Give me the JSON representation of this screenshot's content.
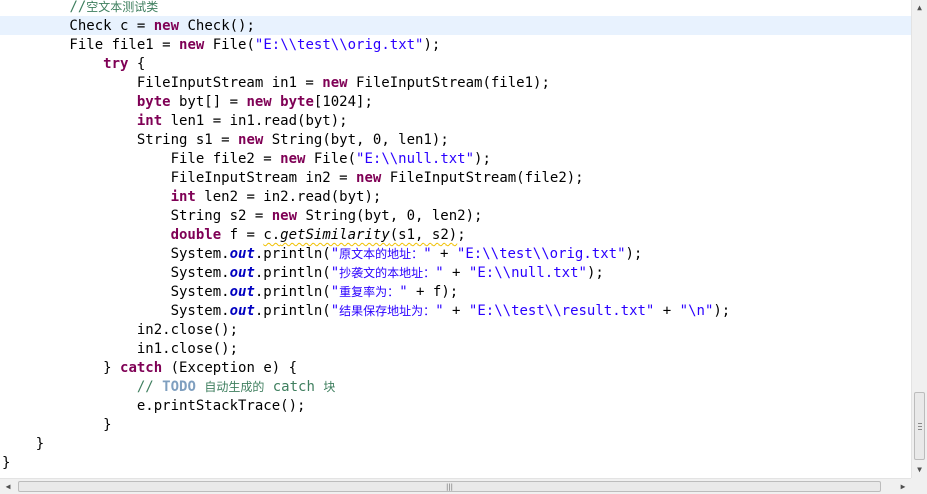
{
  "editor": {
    "language": "java",
    "lines": [
      [
        {
          "c": "        "
        },
        {
          "t": "cmt",
          "c": "//"
        },
        {
          "t": "cmt cjk",
          "c": "空文本测试类"
        }
      ],
      [
        {
          "c": "        Check "
        },
        {
          "t": "var",
          "c": "c"
        },
        {
          "c": " = "
        },
        {
          "t": "kw",
          "c": "new"
        },
        {
          "c": " Check();"
        }
      ],
      [
        {
          "c": "        File "
        },
        {
          "c": "file1"
        },
        {
          "c": " = "
        },
        {
          "t": "kw",
          "c": "new"
        },
        {
          "c": " File("
        },
        {
          "t": "str",
          "c": "\"E:\\\\test\\\\orig.txt\""
        },
        {
          "c": ");"
        }
      ],
      [
        {
          "c": "            "
        },
        {
          "t": "kw",
          "c": "try"
        },
        {
          "c": " {"
        }
      ],
      [
        {
          "c": "                FileInputStream in1 = "
        },
        {
          "t": "kw",
          "c": "new"
        },
        {
          "c": " FileInputStream(file1);"
        }
      ],
      [
        {
          "c": "                "
        },
        {
          "t": "kw",
          "c": "byte"
        },
        {
          "c": " byt[] = "
        },
        {
          "t": "kw",
          "c": "new"
        },
        {
          "c": " "
        },
        {
          "t": "kw",
          "c": "byte"
        },
        {
          "c": "[1024];"
        }
      ],
      [
        {
          "c": "                "
        },
        {
          "t": "kw",
          "c": "int"
        },
        {
          "c": " len1 = in1.read(byt);"
        }
      ],
      [
        {
          "c": "                String s1 = "
        },
        {
          "t": "kw",
          "c": "new"
        },
        {
          "c": " String(byt, 0, len1);"
        }
      ],
      [
        {
          "c": "                    File file2 = "
        },
        {
          "t": "kw",
          "c": "new"
        },
        {
          "c": " File("
        },
        {
          "t": "str",
          "c": "\"E:\\\\null.txt\""
        },
        {
          "c": ");"
        }
      ],
      [
        {
          "c": "                    FileInputStream in2 = "
        },
        {
          "t": "kw",
          "c": "new"
        },
        {
          "c": " FileInputStream(file2);"
        }
      ],
      [
        {
          "c": "                    "
        },
        {
          "t": "kw",
          "c": "int"
        },
        {
          "c": " len2 = in2.read(byt);"
        }
      ],
      [
        {
          "c": "                    String s2 = "
        },
        {
          "t": "kw",
          "c": "new"
        },
        {
          "c": " String(byt, 0, len2);"
        }
      ],
      [
        {
          "c": "                    "
        },
        {
          "t": "kw",
          "c": "double"
        },
        {
          "c": " f = "
        },
        {
          "t": "squig",
          "c": "c."
        },
        {
          "t": "mth squig",
          "c": "getSimilarity"
        },
        {
          "t": "squig",
          "c": "(s1, s2)"
        },
        {
          "c": ";"
        }
      ],
      [
        {
          "c": "                    System."
        },
        {
          "t": "fld",
          "c": "out"
        },
        {
          "c": ".println("
        },
        {
          "t": "str",
          "c": "\""
        },
        {
          "t": "str cjk",
          "c": "原文本的地址："
        },
        {
          "t": "str",
          "c": "\""
        },
        {
          "c": " + "
        },
        {
          "t": "str",
          "c": "\"E:\\\\test\\\\orig.txt\""
        },
        {
          "c": ");"
        }
      ],
      [
        {
          "c": "                    System."
        },
        {
          "t": "fld",
          "c": "out"
        },
        {
          "c": ".println("
        },
        {
          "t": "str",
          "c": "\""
        },
        {
          "t": "str cjk",
          "c": "抄袭文的本地址："
        },
        {
          "t": "str",
          "c": "\""
        },
        {
          "c": " + "
        },
        {
          "t": "str",
          "c": "\"E:\\\\null.txt\""
        },
        {
          "c": ");"
        }
      ],
      [
        {
          "c": "                    System."
        },
        {
          "t": "fld",
          "c": "out"
        },
        {
          "c": ".println("
        },
        {
          "t": "str",
          "c": "\""
        },
        {
          "t": "str cjk",
          "c": "重复率为："
        },
        {
          "t": "str",
          "c": "\""
        },
        {
          "c": " + f);"
        }
      ],
      [
        {
          "c": "                    System."
        },
        {
          "t": "fld",
          "c": "out"
        },
        {
          "c": ".println("
        },
        {
          "t": "str",
          "c": "\""
        },
        {
          "t": "str cjk",
          "c": "结果保存地址为："
        },
        {
          "t": "str",
          "c": "\""
        },
        {
          "c": " + "
        },
        {
          "t": "str",
          "c": "\"E:\\\\test\\\\result.txt\""
        },
        {
          "c": " + "
        },
        {
          "t": "str",
          "c": "\"\\n\""
        },
        {
          "c": ");"
        }
      ],
      [
        {
          "c": "                in2.close();"
        }
      ],
      [
        {
          "c": "                in1.close();"
        }
      ],
      [
        {
          "c": "            } "
        },
        {
          "t": "kw",
          "c": "catch"
        },
        {
          "c": " (Exception e) {"
        }
      ],
      [
        {
          "c": "                "
        },
        {
          "t": "cmt",
          "c": "// "
        },
        {
          "t": "todo",
          "c": "TODO"
        },
        {
          "t": "cmt",
          "c": " "
        },
        {
          "t": "cmt cjk",
          "c": "自动生成的"
        },
        {
          "t": "cmt",
          "c": " catch "
        },
        {
          "t": "cmt cjk",
          "c": "块"
        }
      ],
      [
        {
          "c": "                e.printStackTrace();"
        }
      ],
      [
        {
          "c": "            }"
        }
      ],
      [
        {
          "c": "    }"
        }
      ],
      [
        {
          "c": "}"
        }
      ]
    ],
    "current_line_index": 1
  },
  "scrollbars": {
    "vertical_up_icon": "arrow-up-icon",
    "vertical_down_icon": "arrow-down-icon",
    "horizontal_left_icon": "arrow-left-icon",
    "horizontal_right_icon": "arrow-right-icon",
    "horizontal_grip": "|||"
  },
  "colors": {
    "keyword": "#7f0055",
    "string": "#2a00ff",
    "comment": "#3f7f5f",
    "field": "#0000c0",
    "current_line": "#e8f2fe"
  }
}
